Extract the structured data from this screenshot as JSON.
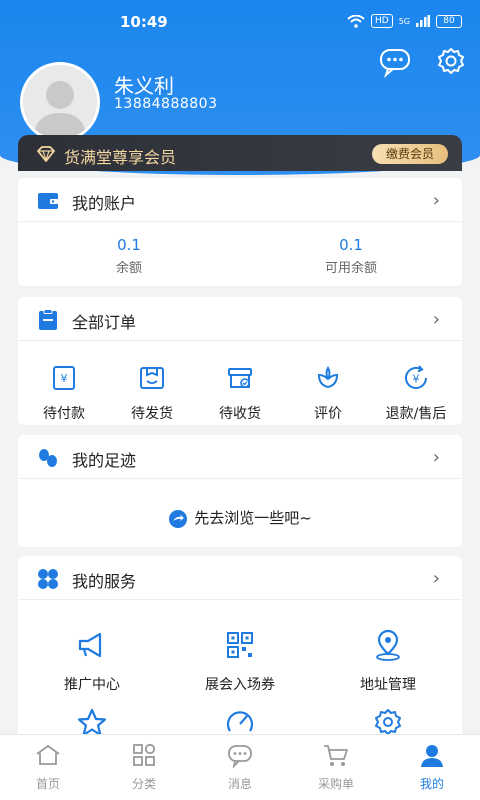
{
  "status_bar": {
    "time": "10:49",
    "hd": "HD",
    "signal": "5G",
    "battery": "80"
  },
  "profile": {
    "name": "朱义利",
    "phone": "13884888803"
  },
  "vip": {
    "label": "货满堂尊享会员",
    "button": "缴费会员"
  },
  "account": {
    "title": "我的账户",
    "items": [
      {
        "value": "0.1",
        "label": "余额"
      },
      {
        "value": "0.1",
        "label": "可用余额"
      }
    ]
  },
  "orders": {
    "title": "全部订单",
    "items": [
      {
        "label": "待付款",
        "icon": "pending-payment-icon"
      },
      {
        "label": "待发货",
        "icon": "pending-shipment-icon"
      },
      {
        "label": "待收货",
        "icon": "pending-receipt-icon"
      },
      {
        "label": "评价",
        "icon": "review-icon"
      },
      {
        "label": "退款/售后",
        "icon": "refund-icon"
      }
    ]
  },
  "footprint": {
    "title": "我的足迹",
    "browse_text": "先去浏览一些吧~"
  },
  "services": {
    "title": "我的服务",
    "items": [
      {
        "label": "推广中心",
        "icon": "megaphone-icon"
      },
      {
        "label": "展会入场券",
        "icon": "qr-code-icon"
      },
      {
        "label": "地址管理",
        "icon": "location-icon"
      }
    ]
  },
  "tabbar": {
    "items": [
      {
        "label": "首页",
        "icon": "home-icon"
      },
      {
        "label": "分类",
        "icon": "category-icon"
      },
      {
        "label": "消息",
        "icon": "message-icon"
      },
      {
        "label": "采购单",
        "icon": "cart-icon"
      },
      {
        "label": "我的",
        "icon": "profile-icon",
        "active": true
      }
    ]
  },
  "colors": {
    "brand": "#1b86ee",
    "accent": "#1f7be0",
    "vip_gold": "#f3d6a0"
  }
}
